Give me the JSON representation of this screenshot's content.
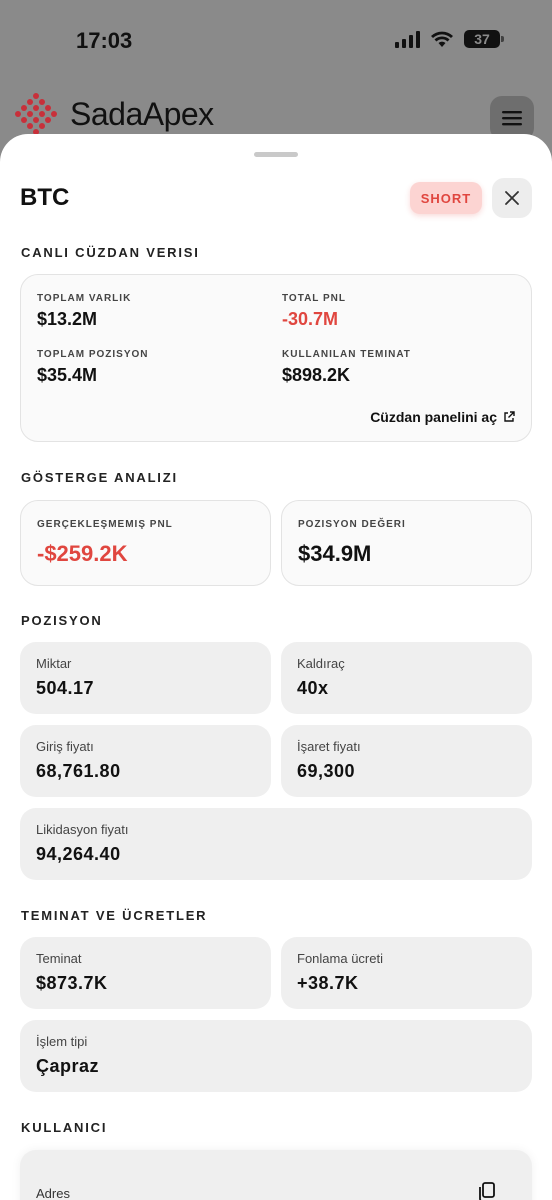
{
  "status_bar": {
    "time": "17:03",
    "battery": "37"
  },
  "app": {
    "logo_text": "SadaApex"
  },
  "sheet": {
    "title": "BTC",
    "side_badge": "SHORT",
    "sections": {
      "wallet": "CANLI CÜZDAN VERISI",
      "indicators": "GÖSTERGE ANALIZI",
      "position": "POZISYON",
      "fees": "TEMINAT VE ÜCRETLER",
      "user": "KULLANICI"
    },
    "wallet": {
      "total_assets_label": "TOPLAM VARLIK",
      "total_assets_value": "$13.2M",
      "total_pnl_label": "TOTAL PNL",
      "total_pnl_value": "-30.7M",
      "total_position_label": "TOPLAM POZISYON",
      "total_position_value": "$35.4M",
      "used_margin_label": "KULLANILAN TEMINAT",
      "used_margin_value": "$898.2K",
      "open_panel_link": "Cüzdan panelini aç"
    },
    "indicators": {
      "unrealized_pnl_label": "GERÇEKLEŞMEMIŞ PNL",
      "unrealized_pnl_value": "-$259.2K",
      "position_value_label": "POZISYON DEĞERI",
      "position_value_value": "$34.9M"
    },
    "position": {
      "amount_label": "Miktar",
      "amount_value": "504.17",
      "leverage_label": "Kaldıraç",
      "leverage_value": "40x",
      "entry_label": "Giriş fiyatı",
      "entry_value": "68,761.80",
      "mark_label": "İşaret fiyatı",
      "mark_value": "69,300",
      "liq_label": "Likidasyon fiyatı",
      "liq_value": "94,264.40"
    },
    "fees": {
      "margin_label": "Teminat",
      "margin_value": "$873.7K",
      "funding_label": "Fonlama ücreti",
      "funding_value": "+38.7K",
      "trade_type_label": "İşlem tipi",
      "trade_type_value": "Çapraz"
    },
    "user": {
      "address_label": "Adres"
    }
  },
  "colors": {
    "negative": "#e0463f",
    "badge_bg": "#fcd4d2",
    "brand": "#c8303a"
  },
  "icons": [
    "signal-icon",
    "wifi-icon",
    "battery-icon",
    "logo-icon",
    "menu-icon",
    "close-icon",
    "external-link-icon",
    "copy-icon"
  ]
}
